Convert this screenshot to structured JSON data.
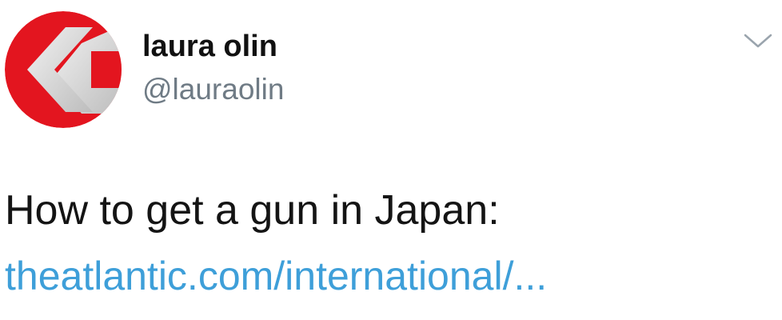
{
  "tweet": {
    "author": {
      "display_name": "laura olin",
      "handle": "@lauraolin",
      "avatar_icon": "red-arrow-logo-icon"
    },
    "menu_icon": "chevron-down-icon",
    "text": "How to get a gun in Japan:",
    "link_text": "theatlantic.com/international/..."
  },
  "colors": {
    "display_name": "#111111",
    "handle": "#6f7b85",
    "text": "#141414",
    "link": "#3e9fd9",
    "avatar_red": "#e3151f",
    "avatar_gray": "#d8d8d8"
  }
}
